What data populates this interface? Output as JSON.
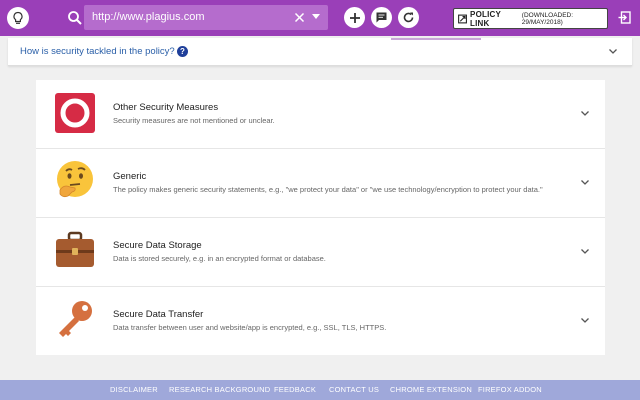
{
  "header": {
    "url": "http://www.plagius.com",
    "policy_link_label": "POLICY LINK",
    "policy_downloaded": "(DOWNLOADED: 29/MAY/2018)"
  },
  "question": {
    "text": "How is security tackled in the policy?",
    "help_glyph": "?"
  },
  "cards": [
    {
      "icon": "no-symbol-icon",
      "title": "Other Security Measures",
      "description": "Security measures are not mentioned or unclear."
    },
    {
      "icon": "thinking-face-icon",
      "title": "Generic",
      "description": "The policy makes generic security statements, e.g., \"we protect your data\" or \"we use technology/encryption to protect your data.\""
    },
    {
      "icon": "briefcase-icon",
      "title": "Secure Data Storage",
      "description": "Data is stored securely, e.g. in an encrypted format or database."
    },
    {
      "icon": "key-icon",
      "title": "Secure Data Transfer",
      "description": "Data transfer between user and website/app is encrypted, e.g., SSL, TLS, HTTPS."
    }
  ],
  "footer": {
    "links": [
      "DISCLAIMER",
      "RESEARCH BACKGROUND",
      "FEEDBACK",
      "CONTACT US",
      "CHROME EXTENSION",
      "FIREFOX ADDON"
    ]
  },
  "colors": {
    "header_bg": "#9a3fb8",
    "footer_bg": "#9fa8da",
    "question_text": "#2a5fa8",
    "no_symbol_red": "#d62b45"
  }
}
